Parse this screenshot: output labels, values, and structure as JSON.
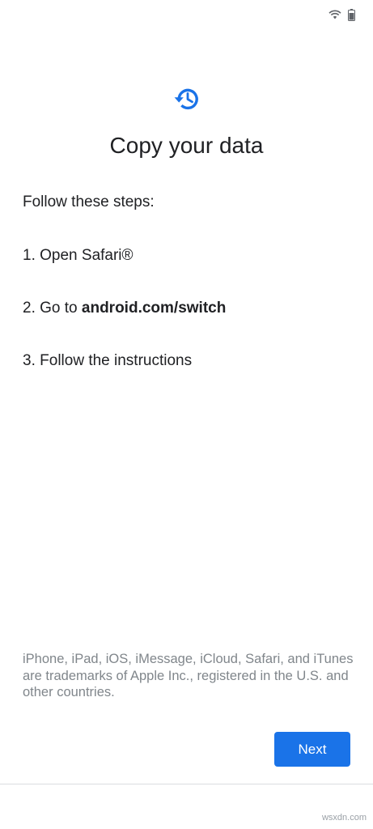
{
  "status_bar": {
    "icons": [
      "wifi-icon",
      "battery-icon"
    ]
  },
  "header": {
    "icon": "restore-history-icon",
    "title": "Copy your data"
  },
  "content": {
    "intro": "Follow these steps:",
    "steps": [
      {
        "number": "1.",
        "text": "Open Safari®",
        "bold": ""
      },
      {
        "number": "2.",
        "text": "Go to",
        "bold": "android.com/switch"
      },
      {
        "number": "3.",
        "text": "Follow the instructions",
        "bold": ""
      }
    ]
  },
  "footer": {
    "disclaimer": "iPhone, iPad, iOS, iMessage, iCloud, Safari, and iTunes are trademarks of Apple Inc., registered in the U.S. and other countries.",
    "next_label": "Next"
  },
  "watermark": "wsxdn.com",
  "colors": {
    "accent": "#1a73e8",
    "text": "#202124",
    "secondary_text": "#80868b",
    "divider": "#dadce0",
    "background": "#ffffff"
  }
}
